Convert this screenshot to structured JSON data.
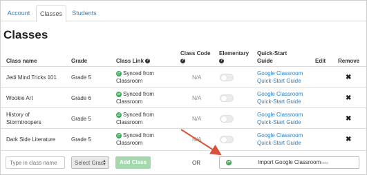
{
  "tabs": [
    {
      "label": "Account"
    },
    {
      "label": "Classes"
    },
    {
      "label": "Students"
    }
  ],
  "page_title": "Classes",
  "columns": {
    "class_name": "Class name",
    "grade": "Grade",
    "class_link": "Class Link",
    "class_code_line1": "Class Code",
    "elementary": "Elementary",
    "quick_start_line1": "Quick-Start",
    "quick_start_line2": "Guide",
    "edit": "Edit",
    "remove": "Remove"
  },
  "rows": [
    {
      "name_line1": "Jedi Mind Tricks 101",
      "name_line2": "",
      "grade": "Grade 5",
      "link_line1": "Synced from",
      "link_line2": "Classroom",
      "code": "N/A",
      "guide_line1": "Google Classroom",
      "guide_line2": "Quick-Start Guide",
      "remove": "✖"
    },
    {
      "name_line1": "Wookie Art",
      "name_line2": "",
      "grade": "Grade 6",
      "link_line1": "Synced from",
      "link_line2": "Classroom",
      "code": "N/A",
      "guide_line1": "Google Classroom",
      "guide_line2": "Quick-Start Guide",
      "remove": "✖"
    },
    {
      "name_line1": "History of",
      "name_line2": "Stormtroopers",
      "grade": "Grade 5",
      "link_line1": "Synced from",
      "link_line2": "Classroom",
      "code": "N/A",
      "guide_line1": "Google Classroom",
      "guide_line2": "Quick-Start Guide",
      "remove": "✖"
    },
    {
      "name_line1": "Dark Side Literature",
      "name_line2": "",
      "grade": "Grade 5",
      "link_line1": "Synced from",
      "link_line2": "Classroom",
      "code": "N/A",
      "guide_line1": "Google Classroom",
      "guide_line2": "Quick-Start Guide",
      "remove": "✖"
    }
  ],
  "add_form": {
    "class_name_placeholder": "Type in class name",
    "grade_select_value": "Select Grac",
    "add_button": "Add Class",
    "or_text": "OR",
    "import_button": "Import Google Classroom",
    "import_badge": "beta"
  },
  "colors": {
    "link": "#2a7fc1",
    "synced_green": "#3fa857",
    "add_button_bg": "#a6d8ae",
    "arrow": "#d9533a"
  },
  "icons": {
    "help": "help-circle-icon",
    "synced": "google-classroom-icon",
    "remove": "remove-x-icon"
  }
}
